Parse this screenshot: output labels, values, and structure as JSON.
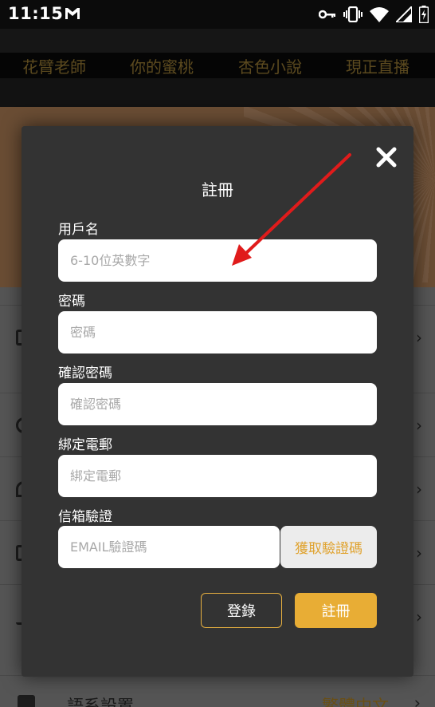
{
  "status_bar": {
    "time": "11:15",
    "icons": [
      "gmail-icon",
      "key-icon",
      "vibrate-icon",
      "wifi-icon",
      "signal-icon",
      "battery-charging-icon"
    ]
  },
  "top_nav": {
    "items": [
      "花臂老師",
      "你的蜜桃",
      "杏色小說",
      "現正直播"
    ]
  },
  "settings": {
    "language_label": "語系設置",
    "language_value": "繁體中文"
  },
  "register_modal": {
    "title": "註冊",
    "close_icon": "close-icon",
    "username": {
      "label": "用戶名",
      "placeholder": "6-10位英數字",
      "value": ""
    },
    "password": {
      "label": "密碼",
      "placeholder": "密碼",
      "value": ""
    },
    "confirm_password": {
      "label": "確認密碼",
      "placeholder": "確認密碼",
      "value": ""
    },
    "bind_email": {
      "label": "綁定電郵",
      "placeholder": "綁定電郵",
      "value": ""
    },
    "email_verify": {
      "label": "信箱驗證",
      "placeholder": "EMAIL驗證碼",
      "value": "",
      "button_label": "獲取驗證碼"
    },
    "login_label": "登錄",
    "register_label": "註冊"
  },
  "colors": {
    "accent": "#e8ad35",
    "modal_bg": "#333333",
    "annotation_arrow": "#e01b1b"
  }
}
